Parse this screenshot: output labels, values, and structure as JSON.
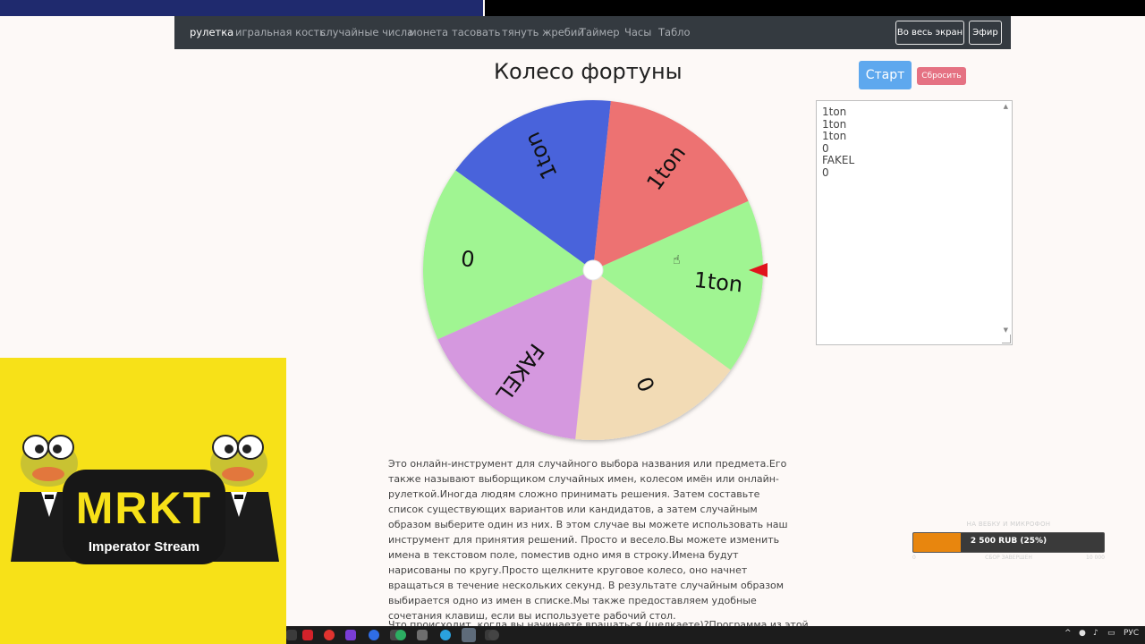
{
  "nav": {
    "links": [
      "рулетка",
      "игральная кость",
      "случайные числа",
      "монета",
      "тасовать",
      "тянуть жребий",
      "Таймер",
      "Часы",
      "Табло"
    ],
    "fullscreen_label": "Во весь экран",
    "broadcast_label": "Эфир"
  },
  "page": {
    "title": "Колесо фортуны",
    "start_label": "Старт",
    "reset_label": "Сбросить"
  },
  "names_text": "1ton\n1ton\n1ton\n0\nFAKEL\n0",
  "wheel": {
    "segments": [
      {
        "label": "1ton",
        "color": "#a0f592"
      },
      {
        "label": "0",
        "color": "#f2dbb5"
      },
      {
        "label": "FAKEL",
        "color": "#d598df"
      },
      {
        "label": "0",
        "color": "#a0f592"
      },
      {
        "label": "1ton",
        "color": "#4864db"
      },
      {
        "label": "1ton",
        "color": "#ed7272"
      }
    ],
    "pointer_color": "#e0141c"
  },
  "description": "Это онлайн-инструмент для случайного выбора названия или предмета.Его также называют выборщиком случайных имен, колесом имён или онлайн-рулеткой.Иногда людям сложно принимать решения. Затем составьте список существующих вариантов или кандидатов, а затем случайным образом выберите один из них. В этом случае вы можете использовать наш инструмент для принятия решений. Просто и весело.Вы можете изменить имена в текстовом поле, поместив одно имя в строку.Имена будут нарисованы по кругу.Просто щелкните круговое колесо, оно начнет вращаться в течение нескольких секунд. В результате случайным образом выбирается одно из имен в списке.Мы также предоставляем удобные сочетания клавиш, если вы используете рабочий стол.",
  "description_2": "Что происходит, когда вы начинаете вращаться (щелкаете)?Программа из этой",
  "overlay": {
    "logo_title": "MRKT",
    "logo_subtitle": "Imperator Stream"
  },
  "goal": {
    "title": "НА ВЕБКУ И МИКРОФОН",
    "amount": "2 500 RUB (25%)",
    "progress": 0.25,
    "min": "0",
    "status": "СБОР ЗАВЕРШЕН",
    "max": "10 000"
  },
  "taskbar": {
    "language": "РУС"
  }
}
